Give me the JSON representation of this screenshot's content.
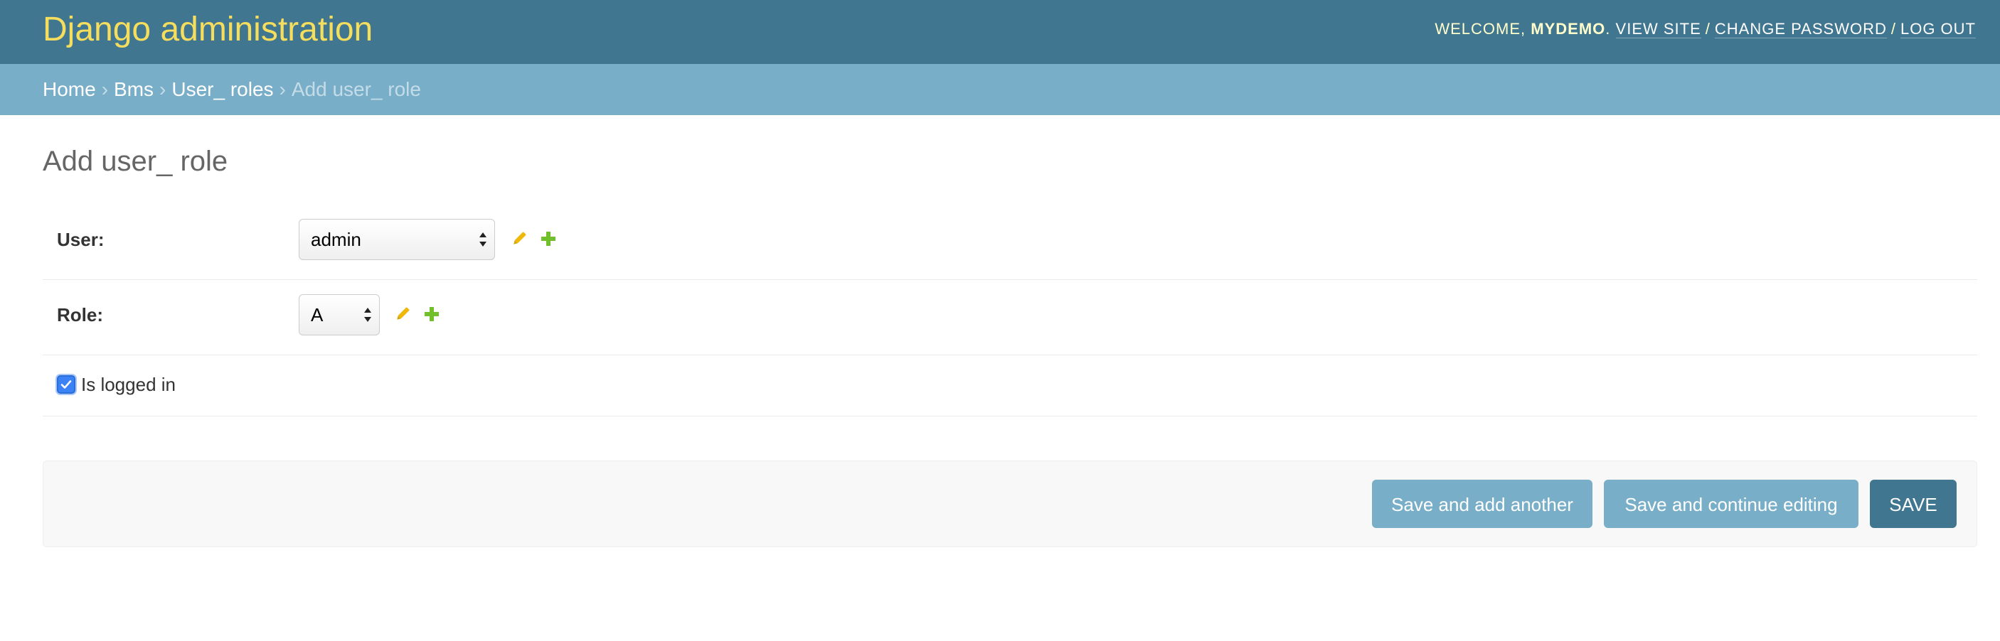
{
  "header": {
    "site_title": "Django administration",
    "welcome_prefix": "Welcome,",
    "username": "mydemo",
    "welcome_suffix": ".",
    "view_site": "View site",
    "change_password": "Change password",
    "log_out": "Log out",
    "separator": "/"
  },
  "breadcrumbs": {
    "items": [
      "Home",
      "Bms",
      "User_ roles"
    ],
    "current": "Add user_ role",
    "separator": "›"
  },
  "page": {
    "title": "Add user_ role"
  },
  "form": {
    "user": {
      "label": "User:",
      "selected": "admin"
    },
    "role": {
      "label": "Role:",
      "selected": "A"
    },
    "is_logged_in": {
      "label": "Is logged in",
      "checked": true
    }
  },
  "buttons": {
    "save_add_another": "Save and add another",
    "save_continue": "Save and continue editing",
    "save": "Save"
  },
  "colors": {
    "header_bg": "#417690",
    "breadcrumb_bg": "#79aec8",
    "brand_title": "#f5dd5d",
    "edit_icon": "#efb80b",
    "add_icon": "#70bf2b",
    "checkbox": "#3b82f6"
  },
  "icons": {
    "edit": "pencil-icon",
    "add": "plus-icon",
    "select_arrow": "select-arrows-icon",
    "checkmark": "checkmark-icon"
  }
}
